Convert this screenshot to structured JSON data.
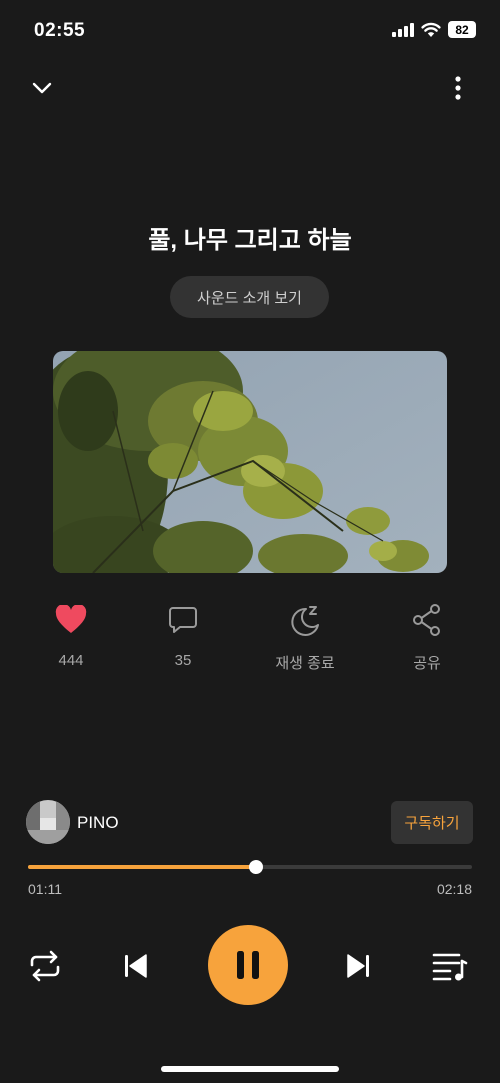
{
  "status": {
    "time": "02:55",
    "battery": "82"
  },
  "track": {
    "title": "풀, 나무 그리고 하늘",
    "intro_label": "사운드 소개 보기"
  },
  "actions": [
    {
      "icon": "heart-icon",
      "label": "444"
    },
    {
      "icon": "comment-icon",
      "label": "35"
    },
    {
      "icon": "sleep-timer-icon",
      "label": "재생 종료"
    },
    {
      "icon": "share-icon",
      "label": "공유"
    }
  ],
  "artist": {
    "name": "PINO",
    "subscribe_label": "구독하기"
  },
  "player": {
    "elapsed": "01:11",
    "duration": "02:18",
    "progress": 0.514
  },
  "colors": {
    "accent": "#f7a33c",
    "like": "#ef4a5f",
    "background": "#1a1a1a"
  }
}
